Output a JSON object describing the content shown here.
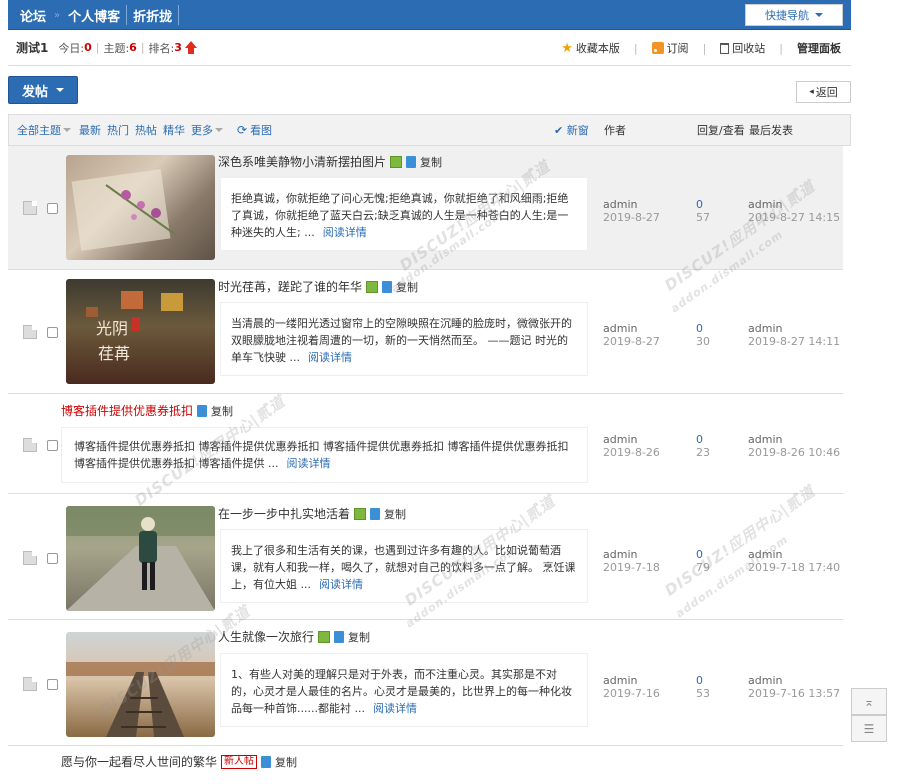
{
  "topbar": {
    "nav": [
      "论坛",
      "个人博客",
      "折折拢"
    ],
    "quick_nav": "快捷导航"
  },
  "forum_info": {
    "name": "测试1",
    "today_label": "今日:",
    "today": "0",
    "topics_label": "主题:",
    "topics": "6",
    "rank_label": "排名:",
    "rank": "3",
    "tools": {
      "favorite": "收藏本版",
      "subscribe": "订阅",
      "recycle": "回收站",
      "manage": "管理面板"
    }
  },
  "actions": {
    "post": "发帖",
    "back": "返回"
  },
  "filter_tabs": {
    "all": "全部主题",
    "latest": "最新",
    "hot": "热门",
    "hot_posts": "热帖",
    "digest": "精华",
    "more": "更多",
    "refresh": "看图",
    "new_window": "新窗"
  },
  "columns": {
    "author": "作者",
    "replies_views": "回复/查看",
    "last_post": "最后发表"
  },
  "threads": [
    {
      "title": "深色系唯美静物小清新摆拍图片",
      "copy": "复制",
      "summary": "拒绝真诚，你就拒绝了问心无愧;拒绝真诚，你就拒绝了和风细雨;拒绝了真诚，你就拒绝了蓝天白云;缺乏真诚的人生是一种苍白的人生;是一种迷失的人生; ...",
      "read_more": "阅读详情",
      "author": "admin",
      "date": "2019-8-27",
      "replies": "0",
      "views": "57",
      "last_author": "admin",
      "last_time": "2019-8-27 14:15"
    },
    {
      "title": "时光荏苒，蹉跎了谁的年华",
      "copy": "复制",
      "summary": "当清晨的一缕阳光透过窗帘上的空隙映照在沉睡的脸庞时，微微张开的双眼朦胧地注视着周遭的一切，新的一天悄然而至。 ——题记 时光的单车飞快驶 ...",
      "read_more": "阅读详情",
      "author": "admin",
      "date": "2019-8-27",
      "replies": "0",
      "views": "30",
      "last_author": "admin",
      "last_time": "2019-8-27 14:11",
      "image_text": "光阴 荏苒"
    },
    {
      "title": "博客插件提供优惠券抵扣",
      "copy": "复制",
      "summary": "博客插件提供优惠券抵扣 博客插件提供优惠券抵扣 博客插件提供优惠券抵扣 博客插件提供优惠券抵扣 博客插件提供优惠券抵扣 博客插件提供 ...",
      "read_more": "阅读详情",
      "author": "admin",
      "date": "2019-8-26",
      "replies": "0",
      "views": "23",
      "last_author": "admin",
      "last_time": "2019-8-26 10:46"
    },
    {
      "title": "在一步一步中扎实地活着",
      "copy": "复制",
      "summary": "我上了很多和生活有关的课，也遇到过许多有趣的人。比如说葡萄酒课，就有人和我一样，喝久了，就想对自己的饮料多一点了解。 烹饪课上，有位大姐 ...",
      "read_more": "阅读详情",
      "author": "admin",
      "date": "2019-7-18",
      "replies": "0",
      "views": "79",
      "last_author": "admin",
      "last_time": "2019-7-18 17:40"
    },
    {
      "title": "人生就像一次旅行",
      "copy": "复制",
      "summary": "1、有些人对美的理解只是对于外表，而不注重心灵。其实那是不对的，心灵才是人最佳的名片。心灵才是最美的，比世界上的每一种化妆品每一种首饰......都能衬 ...",
      "read_more": "阅读详情",
      "author": "admin",
      "date": "2019-7-16",
      "replies": "0",
      "views": "53",
      "last_author": "admin",
      "last_time": "2019-7-16 13:57"
    },
    {
      "title": "愿与你一起看尽人世间的繁华",
      "new_badge": "新人帖",
      "copy": "复制"
    }
  ],
  "watermark": {
    "brand": "DISCUZ!应用中心|贰道",
    "url": "addon.dismall.com"
  },
  "colors": {
    "primary": "#2b6cb3",
    "accent_red": "#cc0000",
    "row_highlight": "#f0f0f0"
  }
}
